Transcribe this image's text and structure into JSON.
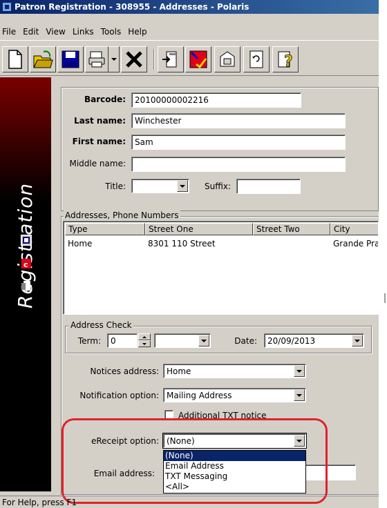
{
  "window": {
    "title": "Patron Registration - 308955 - Addresses - Polaris"
  },
  "menu": [
    "File",
    "Edit",
    "View",
    "Links",
    "Tools",
    "Help"
  ],
  "toolbar": {
    "buttons": [
      "new-document-icon",
      "open-folder-icon",
      "save-disk-icon",
      "print-icon",
      "delete-x-icon",
      "send-to-icon",
      "check-in-icon",
      "properties-icon",
      "refresh-icon",
      "help-icon"
    ]
  },
  "sidebar": {
    "title": "Registration"
  },
  "form": {
    "barcode_label": "Barcode:",
    "barcode_value": "20100000002216",
    "lastname_label": "Last name:",
    "lastname_value": "Winchester",
    "firstname_label": "First name:",
    "firstname_value": "Sam",
    "middlename_label": "Middle name:",
    "middlename_value": "",
    "title_label": "Title:",
    "title_value": "",
    "suffix_label": "Suffix:",
    "suffix_value": ""
  },
  "addresses": {
    "group_title": "Addresses, Phone Numbers",
    "columns": [
      "Type",
      "Street One",
      "Street Two",
      "City"
    ],
    "rows": [
      [
        "Home",
        "8301 110 Street",
        "",
        "Grande Pra"
      ]
    ]
  },
  "address_check": {
    "group_title": "Address Check",
    "term_label": "Term:",
    "term_value": "0",
    "unit_value": "",
    "date_label": "Date:",
    "date_value": "20/09/2013"
  },
  "notices": {
    "notices_address_label": "Notices address:",
    "notices_address_value": "Home",
    "notification_option_label": "Notification option:",
    "notification_option_value": "Mailing Address",
    "additional_txt_label": "Additional TXT notice",
    "ereceipt_label": "eReceipt option:",
    "ereceipt_value": "(None)",
    "ereceipt_options": [
      "(None)",
      "Email Address",
      "TXT Messaging",
      "<All>"
    ],
    "email_label": "Email address:"
  },
  "status": {
    "text": "For Help, press F1"
  },
  "colors": {
    "highlight_ring": "#e0212b",
    "selection": "#0a246a",
    "window_face": "#d4d0c8"
  }
}
